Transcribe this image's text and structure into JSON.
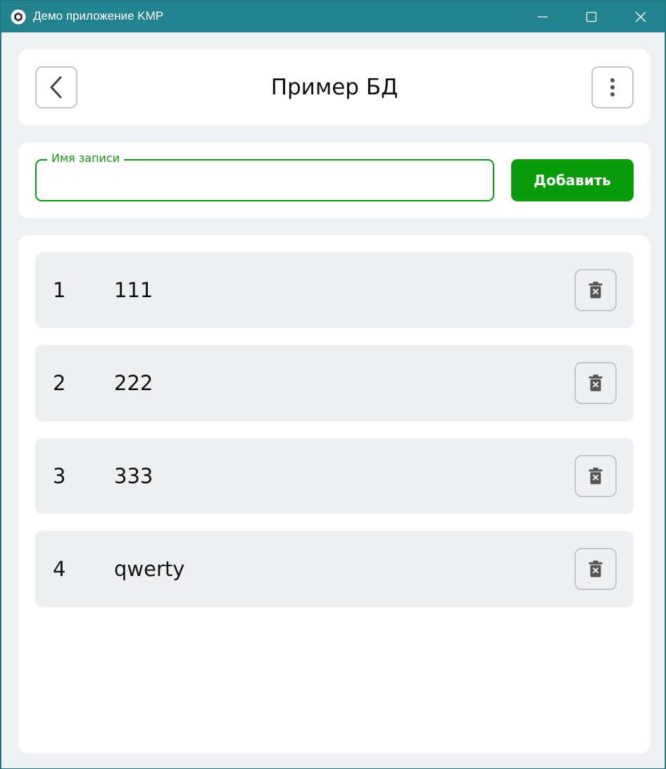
{
  "window": {
    "title": "Демо приложение KMP"
  },
  "header": {
    "title": "Пример БД"
  },
  "form": {
    "field_label": "Имя записи",
    "field_value": "",
    "add_label": "Добавить"
  },
  "records": [
    {
      "id": "1",
      "name": "111"
    },
    {
      "id": "2",
      "name": "222"
    },
    {
      "id": "3",
      "name": "333"
    },
    {
      "id": "4",
      "name": "qwerty"
    }
  ],
  "colors": {
    "titlebar": "#23828f",
    "accent": "#0a9b0a",
    "background": "#eef0f2",
    "row": "#eeeff1"
  },
  "icons": {
    "app": "app-logo-icon",
    "minimize": "minimize-icon",
    "maximize": "maximize-icon",
    "close": "close-icon",
    "back": "chevron-left-icon",
    "more": "more-vertical-icon",
    "delete": "trash-icon"
  }
}
